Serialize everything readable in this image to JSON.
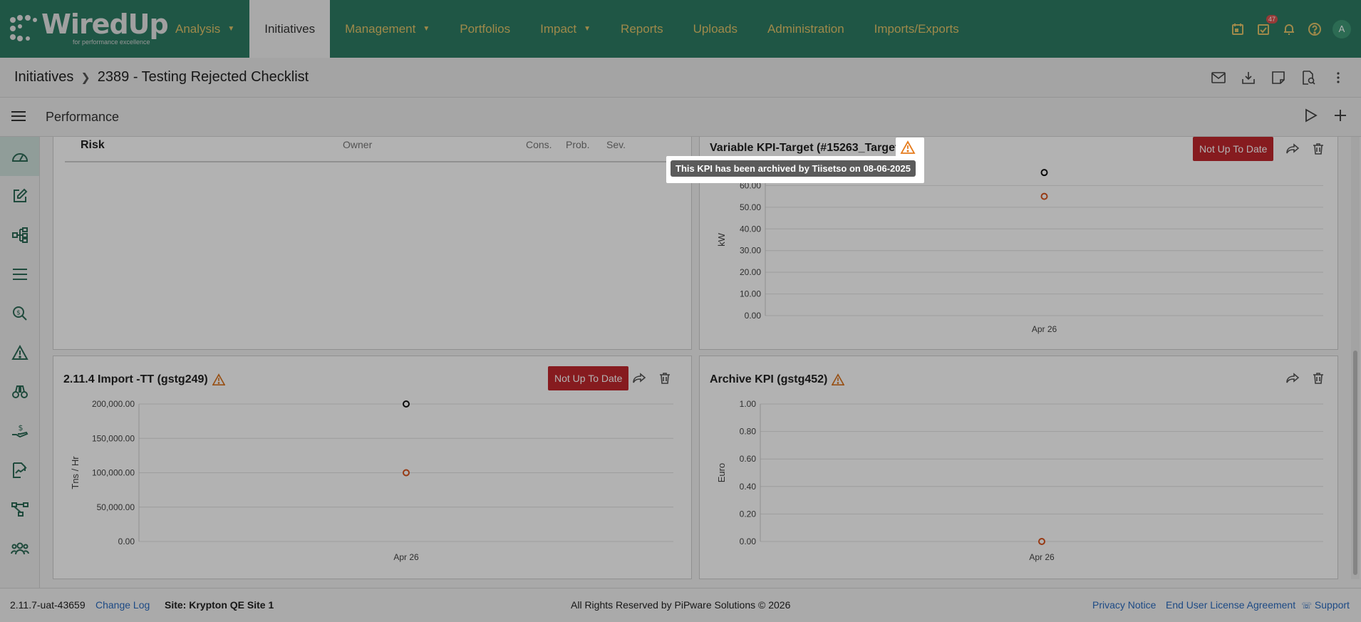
{
  "app": {
    "logo_text": "WiredUp",
    "logo_tagline": "for performance excellence"
  },
  "nav": [
    {
      "label": "Analysis",
      "dropdown": true
    },
    {
      "label": "Initiatives",
      "active": true
    },
    {
      "label": "Management",
      "dropdown": true
    },
    {
      "label": "Portfolios"
    },
    {
      "label": "Impact",
      "dropdown": true
    },
    {
      "label": "Reports"
    },
    {
      "label": "Uploads"
    },
    {
      "label": "Administration"
    },
    {
      "label": "Imports/Exports"
    }
  ],
  "top_icons": {
    "tasks_badge": "47",
    "avatar_initial": "A"
  },
  "breadcrumb": {
    "root": "Initiatives",
    "current": "2389 - Testing Rejected Checklist"
  },
  "subbar": {
    "title": "Performance"
  },
  "risk_panel": {
    "title": "Risk",
    "col_owner": "Owner",
    "col_cons": "Cons.",
    "col_prob": "Prob.",
    "col_sev": "Sev."
  },
  "panels": {
    "variable": {
      "title": "Variable KPI-Target (#15263_Target)",
      "status": "Not Up To Date"
    },
    "import": {
      "title": "2.11.4 Import -TT (gstg249)",
      "status": "Not Up To Date"
    },
    "archive": {
      "title": "Archive KPI (gstg452)"
    }
  },
  "tooltip": {
    "text": "This KPI has been archived by Tiisetso on 08-06-2025"
  },
  "chart_data": [
    {
      "type": "scatter",
      "ylabel": "kW",
      "ylim": [
        0,
        70
      ],
      "yticks": [
        "0.00",
        "10.00",
        "20.00",
        "30.00",
        "40.00",
        "50.00",
        "60.00"
      ],
      "categories": [
        "Apr 26"
      ],
      "series": [
        {
          "color": "#111111",
          "values": [
            66
          ]
        },
        {
          "color": "#d9541e",
          "values": [
            55
          ]
        }
      ]
    },
    {
      "type": "scatter",
      "ylabel": "Tns / Hr",
      "ylim": [
        0,
        200000
      ],
      "yticks": [
        "0.00",
        "50,000.00",
        "100,000.00",
        "150,000.00",
        "200,000.00"
      ],
      "categories": [
        "Apr 26"
      ],
      "series": [
        {
          "color": "#111111",
          "values": [
            200000
          ]
        },
        {
          "color": "#d9541e",
          "values": [
            100000
          ]
        }
      ]
    },
    {
      "type": "scatter",
      "ylabel": "Euro",
      "ylim": [
        0,
        1
      ],
      "yticks": [
        "0.00",
        "0.20",
        "0.40",
        "0.60",
        "0.80",
        "1.00"
      ],
      "categories": [
        "Apr 26"
      ],
      "series": [
        {
          "color": "#d9541e",
          "values": [
            0
          ]
        }
      ]
    }
  ],
  "footer": {
    "version": "2.11.7-uat-43659",
    "changelog": "Change Log",
    "site": "Site: Krypton QE Site 1",
    "copyright": "All Rights Reserved by PiPware Solutions © 2026",
    "privacy": "Privacy Notice",
    "eula": "End User License Agreement",
    "support": "Support"
  }
}
